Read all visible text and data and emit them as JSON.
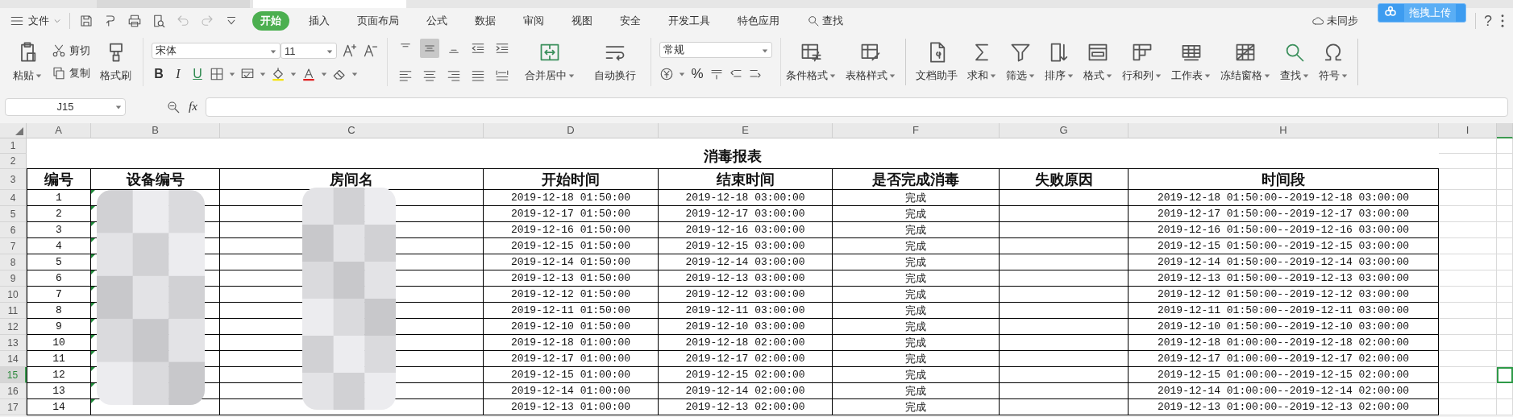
{
  "menu": {
    "file": "文件",
    "tabs": [
      {
        "label": "开始",
        "selected": true
      },
      {
        "label": "插入",
        "selected": false
      },
      {
        "label": "页面布局",
        "selected": false
      },
      {
        "label": "公式",
        "selected": false
      },
      {
        "label": "数据",
        "selected": false
      },
      {
        "label": "审阅",
        "selected": false
      },
      {
        "label": "视图",
        "selected": false
      },
      {
        "label": "安全",
        "selected": false
      },
      {
        "label": "开发工具",
        "selected": false
      },
      {
        "label": "特色应用",
        "selected": false
      }
    ],
    "search": "查找",
    "sync": "未同步",
    "upload": "拖拽上传",
    "help": "?"
  },
  "ribbon": {
    "paste": "粘贴",
    "cut": "剪切",
    "copy": "复制",
    "painter": "格式刷",
    "font_name": "宋体",
    "font_size": "11",
    "bold": "B",
    "italic": "I",
    "underline": "U",
    "valign": [
      {
        "selected": false
      },
      {
        "selected": true
      },
      {
        "selected": false
      }
    ],
    "merge": "合并居中",
    "wrap": "自动换行",
    "number_format": "常规",
    "percent": "%",
    "tools": [
      {
        "label": "条件格式",
        "menu": true
      },
      {
        "label": "表格样式",
        "menu": true
      },
      {
        "label": "文档助手",
        "menu": false
      },
      {
        "label": "求和",
        "menu": true
      },
      {
        "label": "筛选",
        "menu": true
      },
      {
        "label": "排序",
        "menu": true
      },
      {
        "label": "格式",
        "menu": true
      },
      {
        "label": "行和列",
        "menu": true
      },
      {
        "label": "工作表",
        "menu": true
      },
      {
        "label": "冻结窗格",
        "menu": true
      },
      {
        "label": "查找",
        "menu": true
      },
      {
        "label": "符号",
        "menu": true
      }
    ]
  },
  "formula_bar": {
    "name_box": "J15",
    "fx": "fx"
  },
  "sheet": {
    "columns": [
      {
        "label": "A",
        "selected": false
      },
      {
        "label": "B",
        "selected": false
      },
      {
        "label": "C",
        "selected": false
      },
      {
        "label": "D",
        "selected": false
      },
      {
        "label": "E",
        "selected": false
      },
      {
        "label": "F",
        "selected": false
      },
      {
        "label": "G",
        "selected": false
      },
      {
        "label": "H",
        "selected": false
      },
      {
        "label": "I",
        "selected": false
      }
    ],
    "partial_column_selected": true,
    "title_rows": [
      "1",
      "2"
    ],
    "title": "消毒报表",
    "header_row": "3",
    "headers": [
      "编号",
      "设备编号",
      "房间名",
      "开始时间",
      "结束时间",
      "是否完成消毒",
      "失败原因",
      "时间段"
    ],
    "rows": [
      {
        "row": "4",
        "selected": false,
        "no": "1",
        "start": "2019-12-18 01:50:00",
        "end": "2019-12-18 03:00:00",
        "status": "完成",
        "range": "2019-12-18 01:50:00--2019-12-18 03:00:00"
      },
      {
        "row": "5",
        "selected": false,
        "no": "2",
        "start": "2019-12-17 01:50:00",
        "end": "2019-12-17 03:00:00",
        "status": "完成",
        "range": "2019-12-17 01:50:00--2019-12-17 03:00:00"
      },
      {
        "row": "6",
        "selected": false,
        "no": "3",
        "start": "2019-12-16 01:50:00",
        "end": "2019-12-16 03:00:00",
        "status": "完成",
        "range": "2019-12-16 01:50:00--2019-12-16 03:00:00"
      },
      {
        "row": "7",
        "selected": false,
        "no": "4",
        "start": "2019-12-15 01:50:00",
        "end": "2019-12-15 03:00:00",
        "status": "完成",
        "range": "2019-12-15 01:50:00--2019-12-15 03:00:00"
      },
      {
        "row": "8",
        "selected": false,
        "no": "5",
        "start": "2019-12-14 01:50:00",
        "end": "2019-12-14 03:00:00",
        "status": "完成",
        "range": "2019-12-14 01:50:00--2019-12-14 03:00:00"
      },
      {
        "row": "9",
        "selected": false,
        "no": "6",
        "start": "2019-12-13 01:50:00",
        "end": "2019-12-13 03:00:00",
        "status": "完成",
        "range": "2019-12-13 01:50:00--2019-12-13 03:00:00"
      },
      {
        "row": "10",
        "selected": false,
        "no": "7",
        "start": "2019-12-12 01:50:00",
        "end": "2019-12-12 03:00:00",
        "status": "完成",
        "range": "2019-12-12 01:50:00--2019-12-12 03:00:00"
      },
      {
        "row": "11",
        "selected": false,
        "no": "8",
        "start": "2019-12-11 01:50:00",
        "end": "2019-12-11 03:00:00",
        "status": "完成",
        "range": "2019-12-11 01:50:00--2019-12-11 03:00:00"
      },
      {
        "row": "12",
        "selected": false,
        "no": "9",
        "start": "2019-12-10 01:50:00",
        "end": "2019-12-10 03:00:00",
        "status": "完成",
        "range": "2019-12-10 01:50:00--2019-12-10 03:00:00"
      },
      {
        "row": "13",
        "selected": false,
        "no": "10",
        "start": "2019-12-18 01:00:00",
        "end": "2019-12-18 02:00:00",
        "status": "完成",
        "range": "2019-12-18 01:00:00--2019-12-18 02:00:00"
      },
      {
        "row": "14",
        "selected": false,
        "no": "11",
        "start": "2019-12-17 01:00:00",
        "end": "2019-12-17 02:00:00",
        "status": "完成",
        "range": "2019-12-17 01:00:00--2019-12-17 02:00:00"
      },
      {
        "row": "15",
        "selected": true,
        "no": "12",
        "start": "2019-12-15 01:00:00",
        "end": "2019-12-15 02:00:00",
        "status": "完成",
        "range": "2019-12-15 01:00:00--2019-12-15 02:00:00"
      },
      {
        "row": "16",
        "selected": false,
        "no": "13",
        "start": "2019-12-14 01:00:00",
        "end": "2019-12-14 02:00:00",
        "status": "完成",
        "range": "2019-12-14 01:00:00--2019-12-14 02:00:00"
      },
      {
        "row": "17",
        "selected": false,
        "no": "14",
        "start": "2019-12-13 01:00:00",
        "end": "2019-12-13 02:00:00",
        "status": "完成",
        "range": "2019-12-13 01:00:00--2019-12-13 02:00:00"
      }
    ]
  }
}
